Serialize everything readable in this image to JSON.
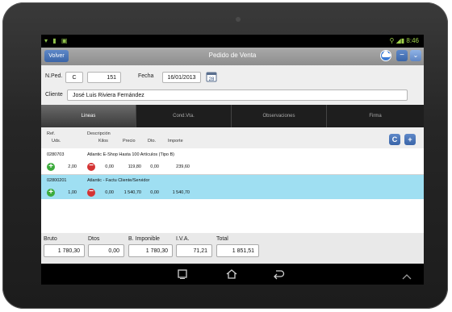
{
  "status": {
    "left_icons": "wifi sd image",
    "right": "8:46"
  },
  "header": {
    "back_label": "Volver",
    "title": "Pedido de Venta"
  },
  "form": {
    "nped_label": "N.Ped.",
    "serie": "C",
    "numero": "151",
    "fecha_label": "Fecha",
    "fecha": "16/01/2013",
    "cliente_label": "Cliente",
    "cliente": "José Luis Riviera Fernández"
  },
  "tabs": [
    {
      "label": "Lineas",
      "active": true
    },
    {
      "label": "Cond.Vta.",
      "active": false
    },
    {
      "label": "Observaciones",
      "active": false
    },
    {
      "label": "Firma",
      "active": false
    }
  ],
  "columns": {
    "ref": "Ref.",
    "uds": "Uds.",
    "descripcion": "Descripción",
    "kilos": "Kilos",
    "precio": "Precio",
    "dto": "Dto.",
    "importe": "Importe"
  },
  "list_buttons": {
    "c_label": "C",
    "add_label": "+"
  },
  "lines": [
    {
      "ref": "0280703",
      "descripcion": "Atlantic E-Shop Hasta 100 Artículos (Tipo B)",
      "uds": "2,00",
      "kilos": "0,00",
      "precio": "119,80",
      "dto": "0,00",
      "importe": "239,60",
      "selected": false
    },
    {
      "ref": "02800201",
      "descripcion": "Atlantic - Factu Cliente/Servidor",
      "uds": "1,00",
      "kilos": "0,00",
      "precio": "1 540,70",
      "dto": "0,00",
      "importe": "1 540,70",
      "selected": true
    }
  ],
  "totals": {
    "bruto_label": "Bruto",
    "bruto": "1 780,30",
    "dtos_label": "Dtos",
    "dtos": "0,00",
    "base_label": "B. Imponible",
    "base": "1 780,30",
    "iva_label": "I.V.A.",
    "iva": "71,21",
    "total_label": "Total",
    "total": "1 851,51"
  },
  "colors": {
    "accent": "#3a65a8",
    "selected_row": "#9fdff2",
    "add": "#3bab3b",
    "remove": "#d43333"
  }
}
